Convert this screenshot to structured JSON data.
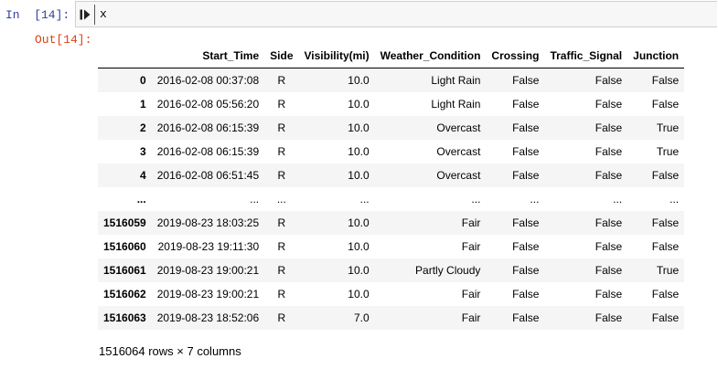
{
  "cells": {
    "input_prompt": "In  [14]:",
    "code": "x",
    "output_prompt": "Out[14]:"
  },
  "dataframe": {
    "columns": [
      "",
      "Start_Time",
      "Side",
      "Visibility(mi)",
      "Weather_Condition",
      "Crossing",
      "Traffic_Signal",
      "Junction"
    ],
    "rows": [
      [
        "0",
        "2016-02-08 00:37:08",
        "R",
        "10.0",
        "Light Rain",
        "False",
        "False",
        "False"
      ],
      [
        "1",
        "2016-02-08 05:56:20",
        "R",
        "10.0",
        "Light Rain",
        "False",
        "False",
        "False"
      ],
      [
        "2",
        "2016-02-08 06:15:39",
        "R",
        "10.0",
        "Overcast",
        "False",
        "False",
        "True"
      ],
      [
        "3",
        "2016-02-08 06:15:39",
        "R",
        "10.0",
        "Overcast",
        "False",
        "False",
        "True"
      ],
      [
        "4",
        "2016-02-08 06:51:45",
        "R",
        "10.0",
        "Overcast",
        "False",
        "False",
        "False"
      ],
      [
        "...",
        "...",
        "...",
        "...",
        "...",
        "...",
        "...",
        "..."
      ],
      [
        "1516059",
        "2019-08-23 18:03:25",
        "R",
        "10.0",
        "Fair",
        "False",
        "False",
        "False"
      ],
      [
        "1516060",
        "2019-08-23 19:11:30",
        "R",
        "10.0",
        "Fair",
        "False",
        "False",
        "False"
      ],
      [
        "1516061",
        "2019-08-23 19:00:21",
        "R",
        "10.0",
        "Partly Cloudy",
        "False",
        "False",
        "True"
      ],
      [
        "1516062",
        "2019-08-23 19:00:21",
        "R",
        "10.0",
        "Fair",
        "False",
        "False",
        "False"
      ],
      [
        "1516063",
        "2019-08-23 18:52:06",
        "R",
        "7.0",
        "Fair",
        "False",
        "False",
        "False"
      ]
    ],
    "shape_text": "1516064 rows × 7 columns"
  },
  "icons": {
    "run": "run-cell-icon"
  },
  "colors": {
    "input_prompt": "#303f9f",
    "output_prompt": "#d84315",
    "input_bg": "#f7f7f7",
    "row_stripe": "#f5f5f5"
  }
}
